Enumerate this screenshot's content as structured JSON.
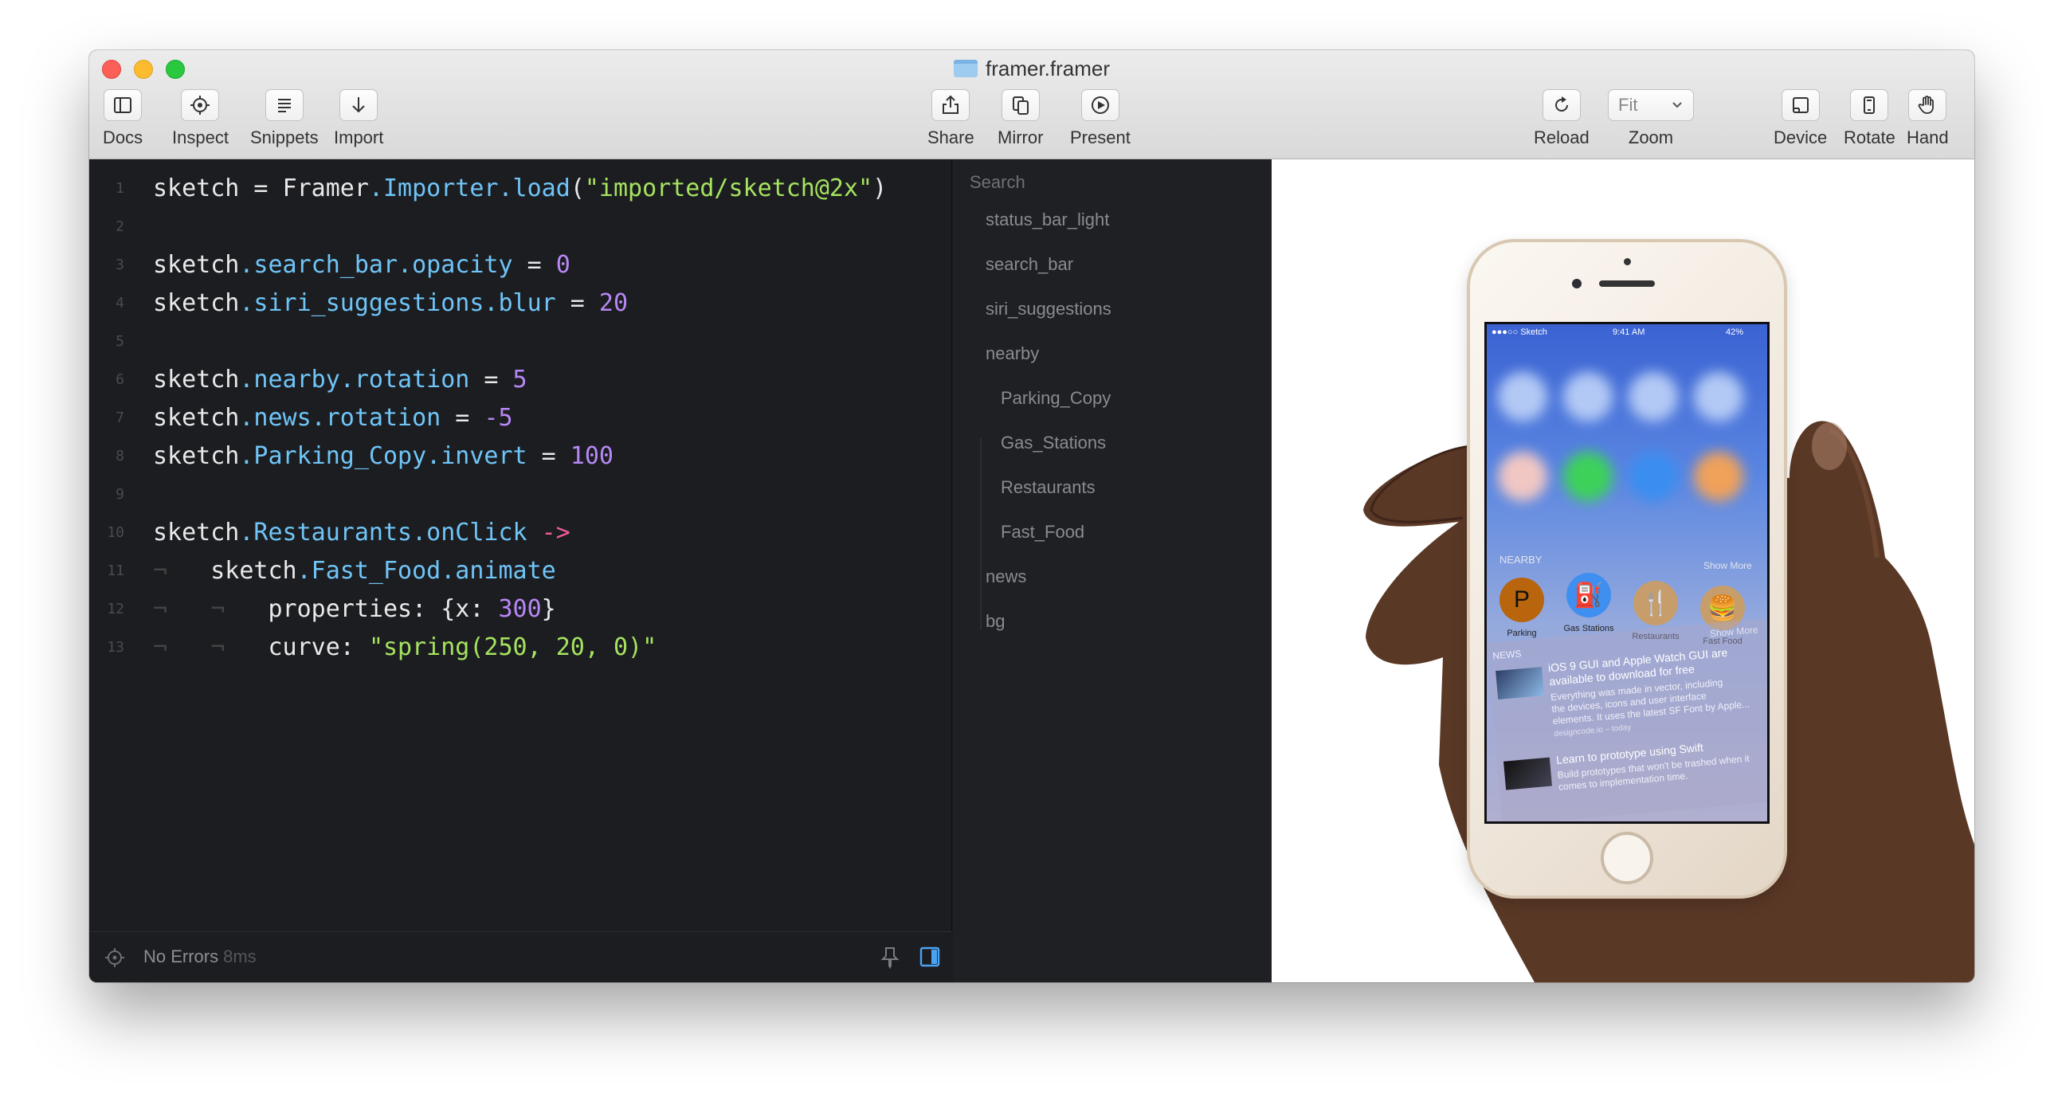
{
  "window": {
    "title": "framer.framer"
  },
  "toolbar": {
    "left": [
      {
        "label": "Docs",
        "icon": "sidebar-icon"
      },
      {
        "label": "Inspect",
        "icon": "crosshair-icon"
      },
      {
        "label": "Snippets",
        "icon": "lines-icon"
      },
      {
        "label": "Import",
        "icon": "arrow-down-icon"
      }
    ],
    "center": [
      {
        "label": "Share",
        "icon": "share-icon"
      },
      {
        "label": "Mirror",
        "icon": "mirror-icon"
      },
      {
        "label": "Present",
        "icon": "play-icon"
      }
    ],
    "reload_label": "Reload",
    "zoom_label": "Zoom",
    "zoom_value": "Fit",
    "right": [
      {
        "label": "Device",
        "icon": "device-icon"
      },
      {
        "label": "Rotate",
        "icon": "rotate-icon"
      },
      {
        "label": "Hand",
        "icon": "hand-icon"
      }
    ]
  },
  "editor": {
    "line_numbers": [
      "1",
      "2",
      "3",
      "4",
      "5",
      "6",
      "7",
      "8",
      "9",
      "10",
      "11",
      "12",
      "13"
    ],
    "lines": {
      "l1": [
        "sketch",
        " = ",
        "Framer",
        ".Importer.load",
        "(",
        "\"imported/sketch@2x\"",
        ")"
      ],
      "l3": [
        "sketch",
        ".search_bar.opacity",
        " = ",
        "0"
      ],
      "l4": [
        "sketch",
        ".siri_suggestions.blur",
        " = ",
        "20"
      ],
      "l6": [
        "sketch",
        ".nearby.rotation",
        " = ",
        "5"
      ],
      "l7": [
        "sketch",
        ".news.rotation",
        " = ",
        "-5"
      ],
      "l8": [
        "sketch",
        ".Parking_Copy.invert",
        " = ",
        "100"
      ],
      "l10": [
        "sketch",
        ".Restaurants.onClick",
        " ",
        "->"
      ],
      "l11": [
        "sketch",
        ".Fast_Food.animate"
      ],
      "l12": [
        "properties: {x: ",
        "300",
        "}"
      ],
      "l13": [
        "curve: ",
        "\"spring(250, 20, 0)\""
      ]
    },
    "indent_marker": "¬",
    "status": "No Errors",
    "status_time": "8ms"
  },
  "layers": {
    "search_placeholder": "Search",
    "items": [
      "status_bar_light",
      "search_bar",
      "siri_suggestions",
      "nearby",
      "Parking_Copy",
      "Gas_Stations",
      "Restaurants",
      "Fast_Food",
      "news",
      "bg"
    ]
  },
  "preview": {
    "status_left": "●●●○○ Sketch",
    "status_time": "9:41 AM",
    "status_right": "42%",
    "nearby_label": "NEARBY",
    "show_more": "Show More",
    "apps": [
      {
        "name": "Parking",
        "glyph": "P",
        "color": "#b8650e"
      },
      {
        "name": "Gas Stations",
        "glyph": "⛽",
        "color": "#3f8ff0"
      },
      {
        "name": "Restaurants",
        "glyph": "🍴",
        "color": "#c79e6b"
      },
      {
        "name": "Fast Food",
        "glyph": "🍔",
        "color": "#c79e6b"
      }
    ],
    "news_label": "NEWS",
    "news": [
      {
        "title1": "iOS 9 GUI and Apple Watch GUI are",
        "title2": "available to download for free",
        "body1": "Everything was made in vector, including",
        "body2": "the devices, icons and user interface",
        "body3": "elements. It uses the latest SF Font by Apple...",
        "meta": "designcode.io – today"
      },
      {
        "title1": "Learn to prototype using Swift",
        "body1": "Build prototypes that won't be trashed when it",
        "body2": "comes to implementation time."
      }
    ]
  }
}
